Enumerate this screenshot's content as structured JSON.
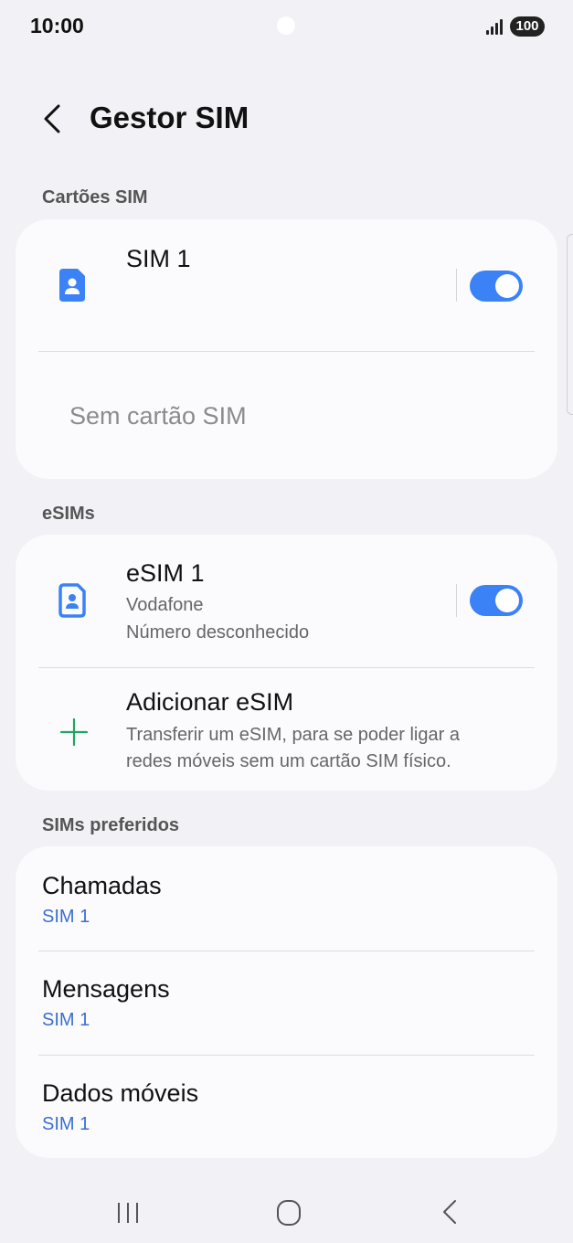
{
  "status_bar": {
    "time": "10:00",
    "battery": "100",
    "icons": [
      "signal-icon",
      "battery-icon"
    ]
  },
  "header": {
    "title": "Gestor SIM",
    "back_icon": "back-arrow-icon"
  },
  "sim_cards": {
    "section_label": "Cartões SIM",
    "sim1": {
      "label": "SIM 1",
      "enabled": true,
      "icon": "sim-card-icon"
    },
    "empty_slot": "Sem cartão SIM"
  },
  "esims": {
    "section_label": "eSIMs",
    "esim1": {
      "label": "eSIM 1",
      "carrier": "Vodafone",
      "number": "Número desconhecido",
      "enabled": true,
      "icon": "esim-card-icon"
    },
    "add": {
      "label": "Adicionar eSIM",
      "description_line1": "Transferir um eSIM, para se poder ligar a",
      "description_line2": "redes móveis sem um cartão SIM físico.",
      "icon": "plus-icon"
    }
  },
  "preferred": {
    "section_label": "SIMs preferidos",
    "items": [
      {
        "label": "Chamadas",
        "value": "SIM 1"
      },
      {
        "label": "Mensagens",
        "value": "SIM 1"
      },
      {
        "label": "Dados móveis",
        "value": "SIM 1"
      }
    ]
  },
  "colors": {
    "accent": "#3b82f6",
    "link": "#3a6fd0",
    "plus": "#1fa463",
    "background": "#f1f1f6",
    "card": "#fbfbfe"
  },
  "nav_bar": {
    "icons": [
      "recents-icon",
      "home-icon",
      "back-icon"
    ]
  }
}
